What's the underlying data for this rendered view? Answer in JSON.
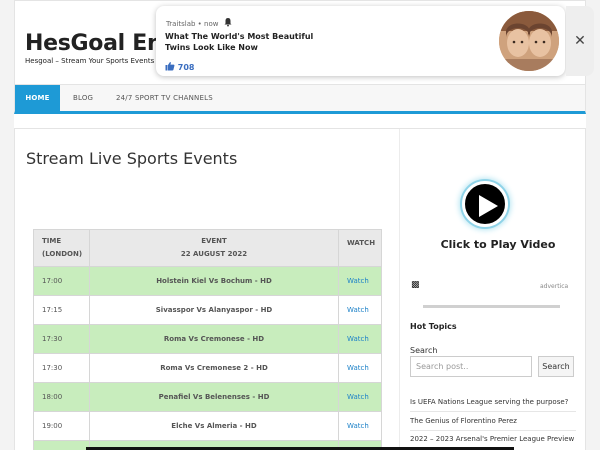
{
  "site": {
    "title": "HesGoal Ent.",
    "tagline": "Hesgoal – Stream Your Sports Events Live"
  },
  "nav": {
    "items": [
      {
        "label": "HOME",
        "active": true
      },
      {
        "label": "BLOG",
        "active": false
      },
      {
        "label": "24/7 SPORT TV CHANNELS",
        "active": false
      }
    ]
  },
  "main": {
    "title": "Stream Live Sports Events",
    "table": {
      "headers": {
        "time_line1": "TIME",
        "time_line2": "(LONDON)",
        "event_line1": "EVENT",
        "event_line2": "22 AUGUST 2022",
        "watch": "WATCH"
      },
      "rows": [
        {
          "time": "17:00",
          "event": "Holstein Kiel Vs Bochum - HD",
          "watch": "Watch"
        },
        {
          "time": "17:15",
          "event": "Sivasspor Vs Alanyaspor - HD",
          "watch": "Watch"
        },
        {
          "time": "17:30",
          "event": "Roma Vs Cremonese - HD",
          "watch": "Watch"
        },
        {
          "time": "17:30",
          "event": "Roma Vs Cremonese 2 - HD",
          "watch": "Watch"
        },
        {
          "time": "18:00",
          "event": "Penafiel Vs Belenenses - HD",
          "watch": "Watch"
        },
        {
          "time": "19:00",
          "event": "Elche Vs Almeria - HD",
          "watch": "Watch"
        }
      ]
    }
  },
  "sidebar": {
    "video_label": "Click to Play Video",
    "ad_logo": "▩",
    "ad_brand": "advertica",
    "hot_topics_heading": "Hot Topics",
    "search": {
      "label": "Search",
      "placeholder": "Search post..",
      "button": "Search"
    },
    "posts": [
      "Is UEFA Nations League serving the purpose?",
      "The Genius of Florentino Perez",
      "2022 – 2023 Arsenal's Premier League Preview"
    ]
  },
  "notification": {
    "source": "Traitslab",
    "time": "now",
    "title": "What The World's Most Beautiful Twins Look Like Now",
    "likes": "708",
    "close_glyph": "✕"
  },
  "colors": {
    "accent": "#1e9ad6",
    "row_alt": "#c8edbd",
    "link": "#1e82c8"
  }
}
